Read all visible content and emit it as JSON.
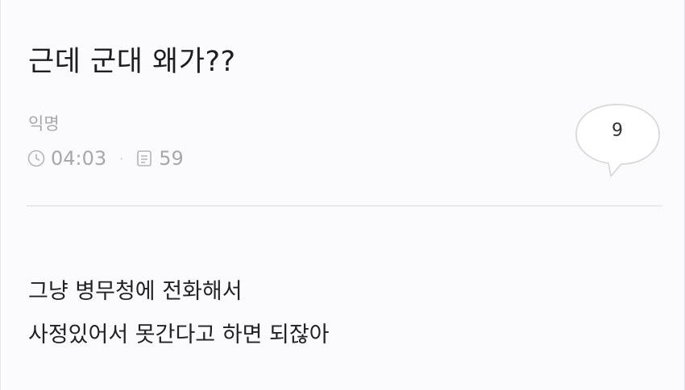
{
  "post": {
    "title": "근데 군대 왜가??",
    "author": "익명",
    "time": "04:03",
    "views": "59",
    "comment_count": "9",
    "body_lines": [
      "그냥 병무청에 전화해서",
      "사정있어서 못간다고 하면 되잖아"
    ]
  },
  "icons": {
    "time": "clock-icon",
    "views": "document-icon",
    "comments": "speech-bubble-icon"
  },
  "colors": {
    "background": "#fbfafd",
    "title": "#1e1e1e",
    "meta": "#a8a8a8",
    "divider": "#ebe9ef"
  }
}
